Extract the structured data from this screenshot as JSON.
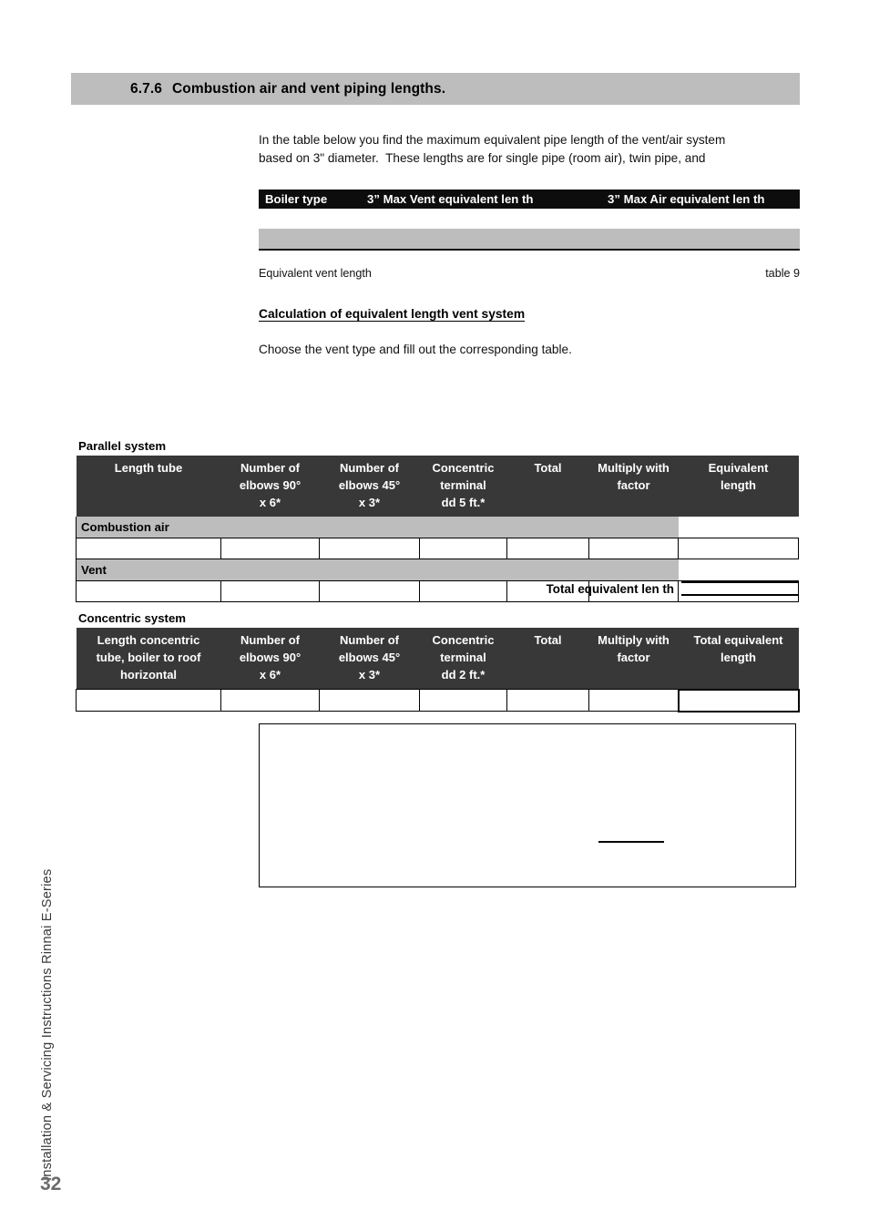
{
  "section": {
    "number": "6.7.6",
    "title": "Combustion air and vent piping lengths."
  },
  "intro": {
    "line1": "In the table below you find the maximum equivalent pipe length of the vent/air system",
    "line2": "based on 3\" diameter.  These lengths are for single pipe (room air), twin pipe, and"
  },
  "boiler_table": {
    "headers": {
      "boiler_type": "Boiler type",
      "max_vent": "3” Max Vent equivalent len  th",
      "max_air": "3” Max Air equivalent len  th"
    },
    "caption_left": "Equivalent vent length",
    "caption_right": "table 9"
  },
  "calculation": {
    "heading": "Calculation of equivalent length vent system",
    "note": "Choose the vent type and fill out the corresponding table."
  },
  "parallel_table": {
    "label": "Parallel system",
    "headers": [
      {
        "l1": "Length tube",
        "l2": "",
        "l3": ""
      },
      {
        "l1": "Number of",
        "l2": "elbows 90°",
        "l3": "x 6*"
      },
      {
        "l1": "Number of",
        "l2": "elbows 45°",
        "l3": "x 3*"
      },
      {
        "l1": "Concentric",
        "l2": "terminal",
        "l3": "dd 5 ft.*"
      },
      {
        "l1": "Total",
        "l2": "",
        "l3": ""
      },
      {
        "l1": "Multiply with",
        "l2": "factor",
        "l3": ""
      },
      {
        "l1": "Equivalent",
        "l2": "length",
        "l3": ""
      }
    ],
    "group_rows": [
      {
        "label": "Combustion air"
      },
      {
        "label": "Vent"
      }
    ],
    "total_label": "Total equivalent len  th"
  },
  "concentric_table": {
    "label": "Concentric system",
    "headers": [
      {
        "l1": "Length concentric",
        "l2": "tube, boiler to roof",
        "l3": "horizontal"
      },
      {
        "l1": "Number of",
        "l2": "elbows 90°",
        "l3": "x 6*"
      },
      {
        "l1": "Number of",
        "l2": "elbows 45°",
        "l3": "x 3*"
      },
      {
        "l1": "Concentric",
        "l2": "terminal",
        "l3": "dd 2 ft.*"
      },
      {
        "l1": "Total",
        "l2": "",
        "l3": ""
      },
      {
        "l1": "Multiply with",
        "l2": "factor",
        "l3": ""
      },
      {
        "l1": "Total equivalent",
        "l2": "length",
        "l3": ""
      }
    ]
  },
  "sidebar": {
    "text": "Installation & Servicing Instructions Rinnai E-Series",
    "page_number": "32"
  },
  "colors": {
    "section_bar": "#bdbdbd",
    "table_header_dark": "#383838",
    "boiler_header_black": "#0d0d0d",
    "group_row_gray": "#bdbdbd"
  }
}
